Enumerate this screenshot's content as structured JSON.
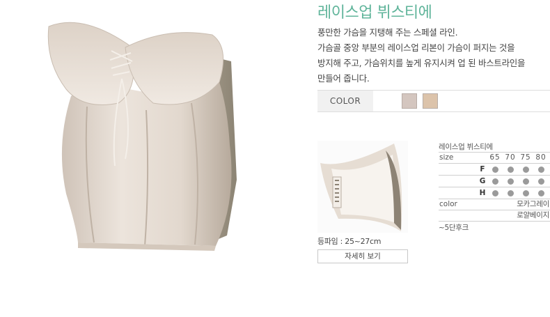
{
  "product": {
    "title": "레이스업 뷔스티에",
    "description_lines": [
      "풍만한 가슴을 지탱해 주는 스페셜 라인.",
      "가슴골 중앙 부분의 레이스업 리본이 가슴이 퍼지는 것을",
      "방지해 주고, 가슴위치를 높게 유지시켜 업 된 바스트라인을",
      "만들어 줍니다."
    ]
  },
  "color_selector": {
    "label": "COLOR",
    "swatches": [
      {
        "name": "모카그레이",
        "hex": "#d4c6bf"
      },
      {
        "name": "로얄베이지",
        "hex": "#dcc3aa"
      }
    ]
  },
  "thumbnail": {
    "back_size_text": "등파임 : 25~27cm",
    "detail_button": "자세히 보기"
  },
  "spec_table": {
    "title": "레이스업 뷔스티에",
    "size_label": "size",
    "sizes": [
      "65",
      "70",
      "75",
      "80"
    ],
    "cups": [
      {
        "cup": "F",
        "available": [
          true,
          true,
          true,
          true
        ]
      },
      {
        "cup": "G",
        "available": [
          true,
          true,
          true,
          true
        ]
      },
      {
        "cup": "H",
        "available": [
          true,
          true,
          true,
          true
        ]
      }
    ],
    "color_label": "color",
    "colors": [
      "모카그레이",
      "로얄베이지"
    ],
    "note": "~5단후크"
  },
  "colors": {
    "title_accent": "#5fb49a",
    "dot": "#9a9a9a",
    "divider": "#cfcfcf"
  }
}
